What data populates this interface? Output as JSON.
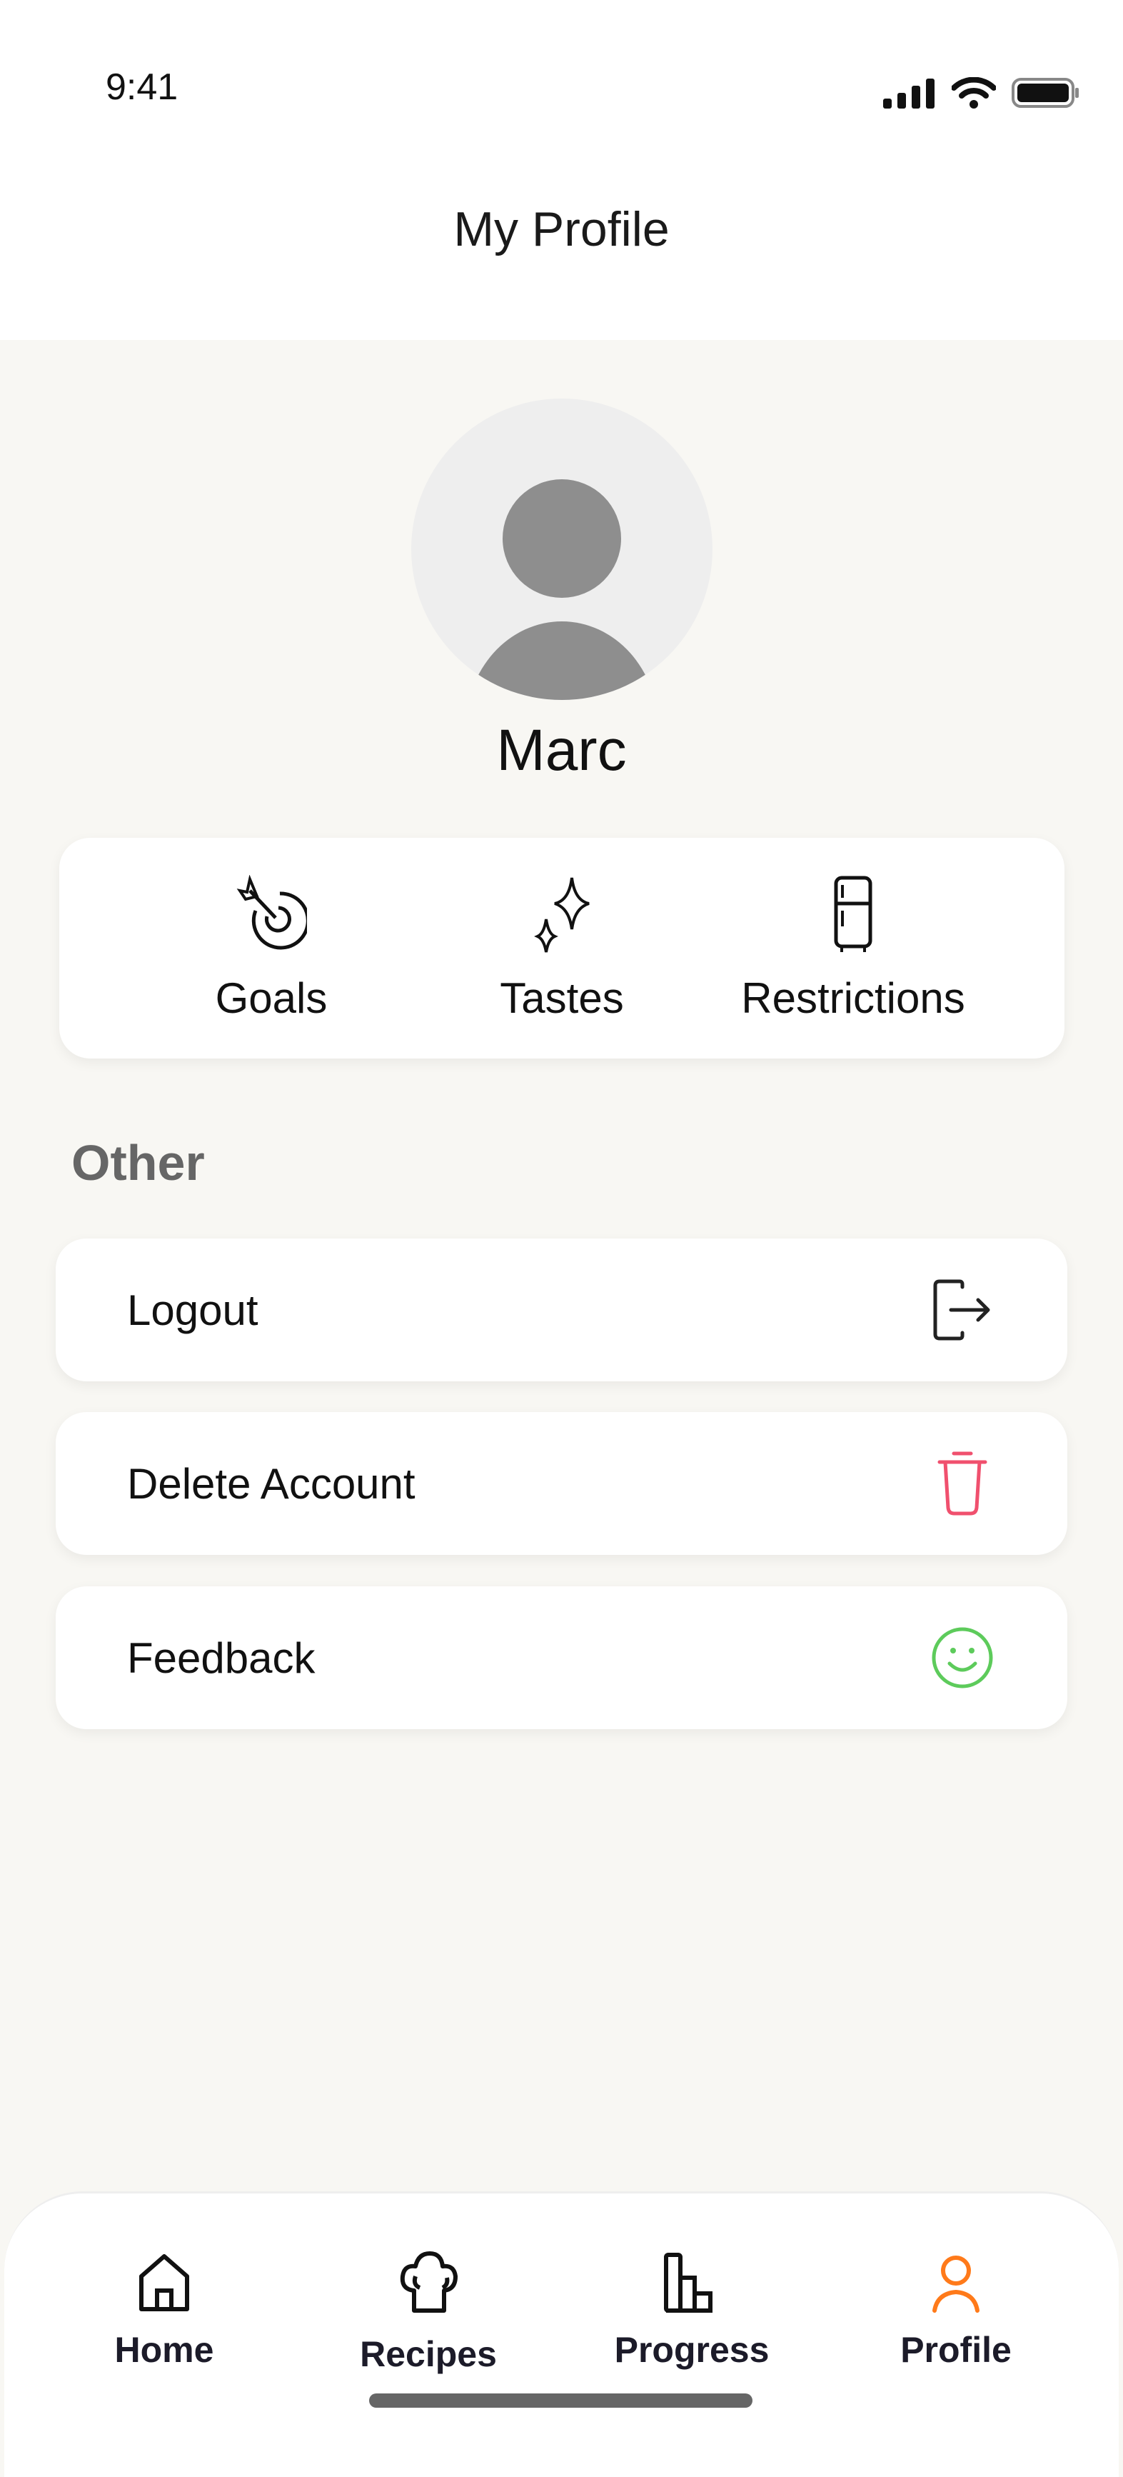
{
  "status_bar": {
    "time": "9:41"
  },
  "header": {
    "title": "My Profile"
  },
  "profile": {
    "name": "Marc"
  },
  "quick_actions": [
    {
      "label": "Goals",
      "icon": "target-arrow-icon"
    },
    {
      "label": "Tastes",
      "icon": "sparkles-icon"
    },
    {
      "label": "Restrictions",
      "icon": "fridge-icon"
    }
  ],
  "other": {
    "heading": "Other",
    "items": [
      {
        "label": "Logout",
        "icon": "logout-icon",
        "color": "#222222"
      },
      {
        "label": "Delete Account",
        "icon": "trash-icon",
        "color": "#F0506E"
      },
      {
        "label": "Feedback",
        "icon": "smiley-icon",
        "color": "#5DCB5B"
      }
    ]
  },
  "nav": {
    "active": "Profile",
    "accent": "#FF7A1A",
    "items": [
      {
        "label": "Home",
        "icon": "home-icon"
      },
      {
        "label": "Recipes",
        "icon": "chef-hat-icon"
      },
      {
        "label": "Progress",
        "icon": "bar-chart-icon"
      },
      {
        "label": "Profile",
        "icon": "user-icon"
      }
    ]
  }
}
